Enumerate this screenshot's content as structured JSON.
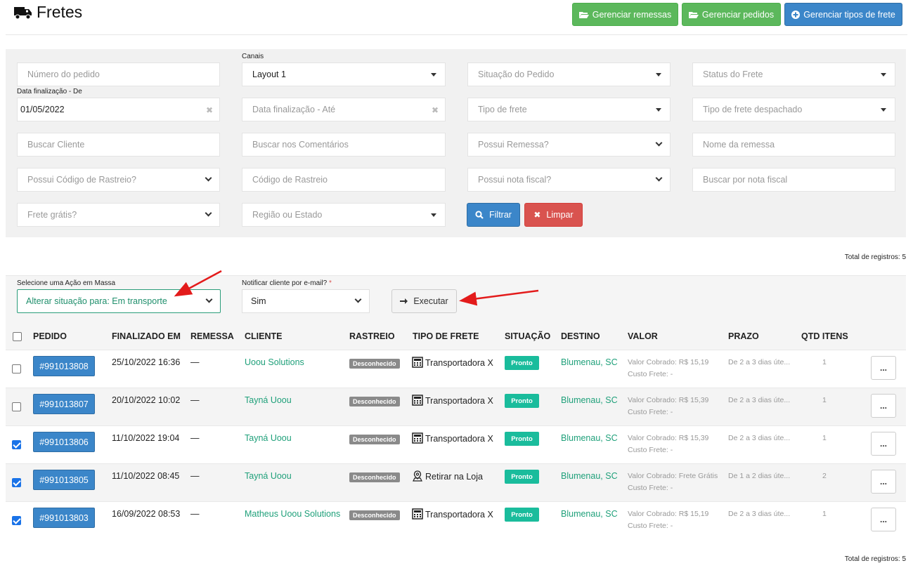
{
  "header": {
    "title": "Fretes",
    "buttons": {
      "manage_shipments": "Gerenciar remessas",
      "manage_orders": "Gerenciar pedidos",
      "manage_freight_types": "Gerenciar tipos de frete"
    }
  },
  "filters": {
    "canais_label": "Canais",
    "date_from_label": "Data finalização - De",
    "order_number_placeholder": "Número do pedido",
    "channel_value": "Layout 1",
    "order_status_placeholder": "Situação do Pedido",
    "freight_status_placeholder": "Status do Frete",
    "date_from_value": "01/05/2022",
    "date_to_placeholder": "Data finalização - Até",
    "freight_type_placeholder": "Tipo de frete",
    "dispatched_freight_type_placeholder": "Tipo de frete despachado",
    "search_client_placeholder": "Buscar Cliente",
    "search_comments_placeholder": "Buscar nos Comentários",
    "has_shipment_placeholder": "Possui Remessa?",
    "shipment_name_placeholder": "Nome da remessa",
    "has_tracking_placeholder": "Possui Código de Rastreio?",
    "tracking_code_placeholder": "Código de Rastreio",
    "has_invoice_placeholder": "Possui nota fiscal?",
    "search_invoice_placeholder": "Buscar por nota fiscal",
    "free_shipping_placeholder": "Frete grátis?",
    "region_placeholder": "Região ou Estado",
    "filter_button": "Filtrar",
    "clear_button": "Limpar"
  },
  "totals": {
    "top": "Total de registros: 5",
    "bottom": "Total de registros: 5"
  },
  "bulk_action": {
    "label": "Selecione uma Ação em Massa",
    "value": "Alterar situação para: Em transporte",
    "notify_label": "Notificar cliente por e-mail?",
    "required_mark": "*",
    "notify_value": "Sim",
    "execute_button": "Executar"
  },
  "table": {
    "columns": [
      "PEDIDO",
      "FINALIZADO EM",
      "REMESSA",
      "CLIENTE",
      "RASTREIO",
      "TIPO DE FRETE",
      "SITUAÇÃO",
      "DESTINO",
      "VALOR",
      "PRAZO",
      "QTD ITENS"
    ],
    "rows": [
      {
        "checked": false,
        "order": "#991013808",
        "finalized": "25/10/2022 16:36",
        "shipment": "—",
        "client": "Uoou Solutions",
        "tracking": "Desconhecido",
        "freight_icon": "calculator-icon",
        "freight_type": "Transportadora X",
        "status": "Pronto",
        "destination": "Blumenau, SC",
        "value_charged": "Valor Cobrado: R$ 15,19",
        "freight_cost": "Custo Frete: -",
        "deadline": "De 2 a 3 dias úte...",
        "qty": "1",
        "more": "..."
      },
      {
        "checked": false,
        "order": "#991013807",
        "finalized": "20/10/2022 10:02",
        "shipment": "—",
        "client": "Tayná Uoou",
        "tracking": "Desconhecido",
        "freight_icon": "calculator-icon",
        "freight_type": "Transportadora X",
        "status": "Pronto",
        "destination": "Blumenau, SC",
        "value_charged": "Valor Cobrado: R$ 15,39",
        "freight_cost": "Custo Frete: -",
        "deadline": "De 2 a 3 dias úte...",
        "qty": "1",
        "more": "..."
      },
      {
        "checked": true,
        "order": "#991013806",
        "finalized": "11/10/2022 19:04",
        "shipment": "—",
        "client": "Tayná Uoou",
        "tracking": "Desconhecido",
        "freight_icon": "calculator-icon",
        "freight_type": "Transportadora X",
        "status": "Pronto",
        "destination": "Blumenau, SC",
        "value_charged": "Valor Cobrado: R$ 15,39",
        "freight_cost": "Custo Frete: -",
        "deadline": "De 2 a 3 dias úte...",
        "qty": "1",
        "more": "..."
      },
      {
        "checked": true,
        "order": "#991013805",
        "finalized": "11/10/2022 08:45",
        "shipment": "—",
        "client": "Tayná Uoou",
        "tracking": "Desconhecido",
        "freight_icon": "store-pin-icon",
        "freight_type": "Retirar na Loja",
        "status": "Pronto",
        "destination": "Blumenau, SC",
        "value_charged": "Valor Cobrado: Frete Grátis",
        "freight_cost": "Custo Frete: -",
        "deadline": "De 1 a 2 dias úte...",
        "qty": "2",
        "more": "..."
      },
      {
        "checked": true,
        "order": "#991013803",
        "finalized": "16/09/2022 08:53",
        "shipment": "—",
        "client": "Matheus Uoou Solutions",
        "tracking": "Desconhecido",
        "freight_icon": "calculator-icon",
        "freight_type": "Transportadora X",
        "status": "Pronto",
        "destination": "Blumenau, SC",
        "value_charged": "Valor Cobrado: R$ 15,19",
        "freight_cost": "Custo Frete: -",
        "deadline": "De 2 a 3 dias úte...",
        "qty": "1",
        "more": "..."
      }
    ]
  },
  "colors": {
    "green_button": "#5cb85c",
    "blue_button": "#3b86c9",
    "red_button": "#d9534f",
    "link_green": "#1fa07a",
    "status_green": "#1abc9c",
    "annotation_red": "#e31b1b"
  }
}
